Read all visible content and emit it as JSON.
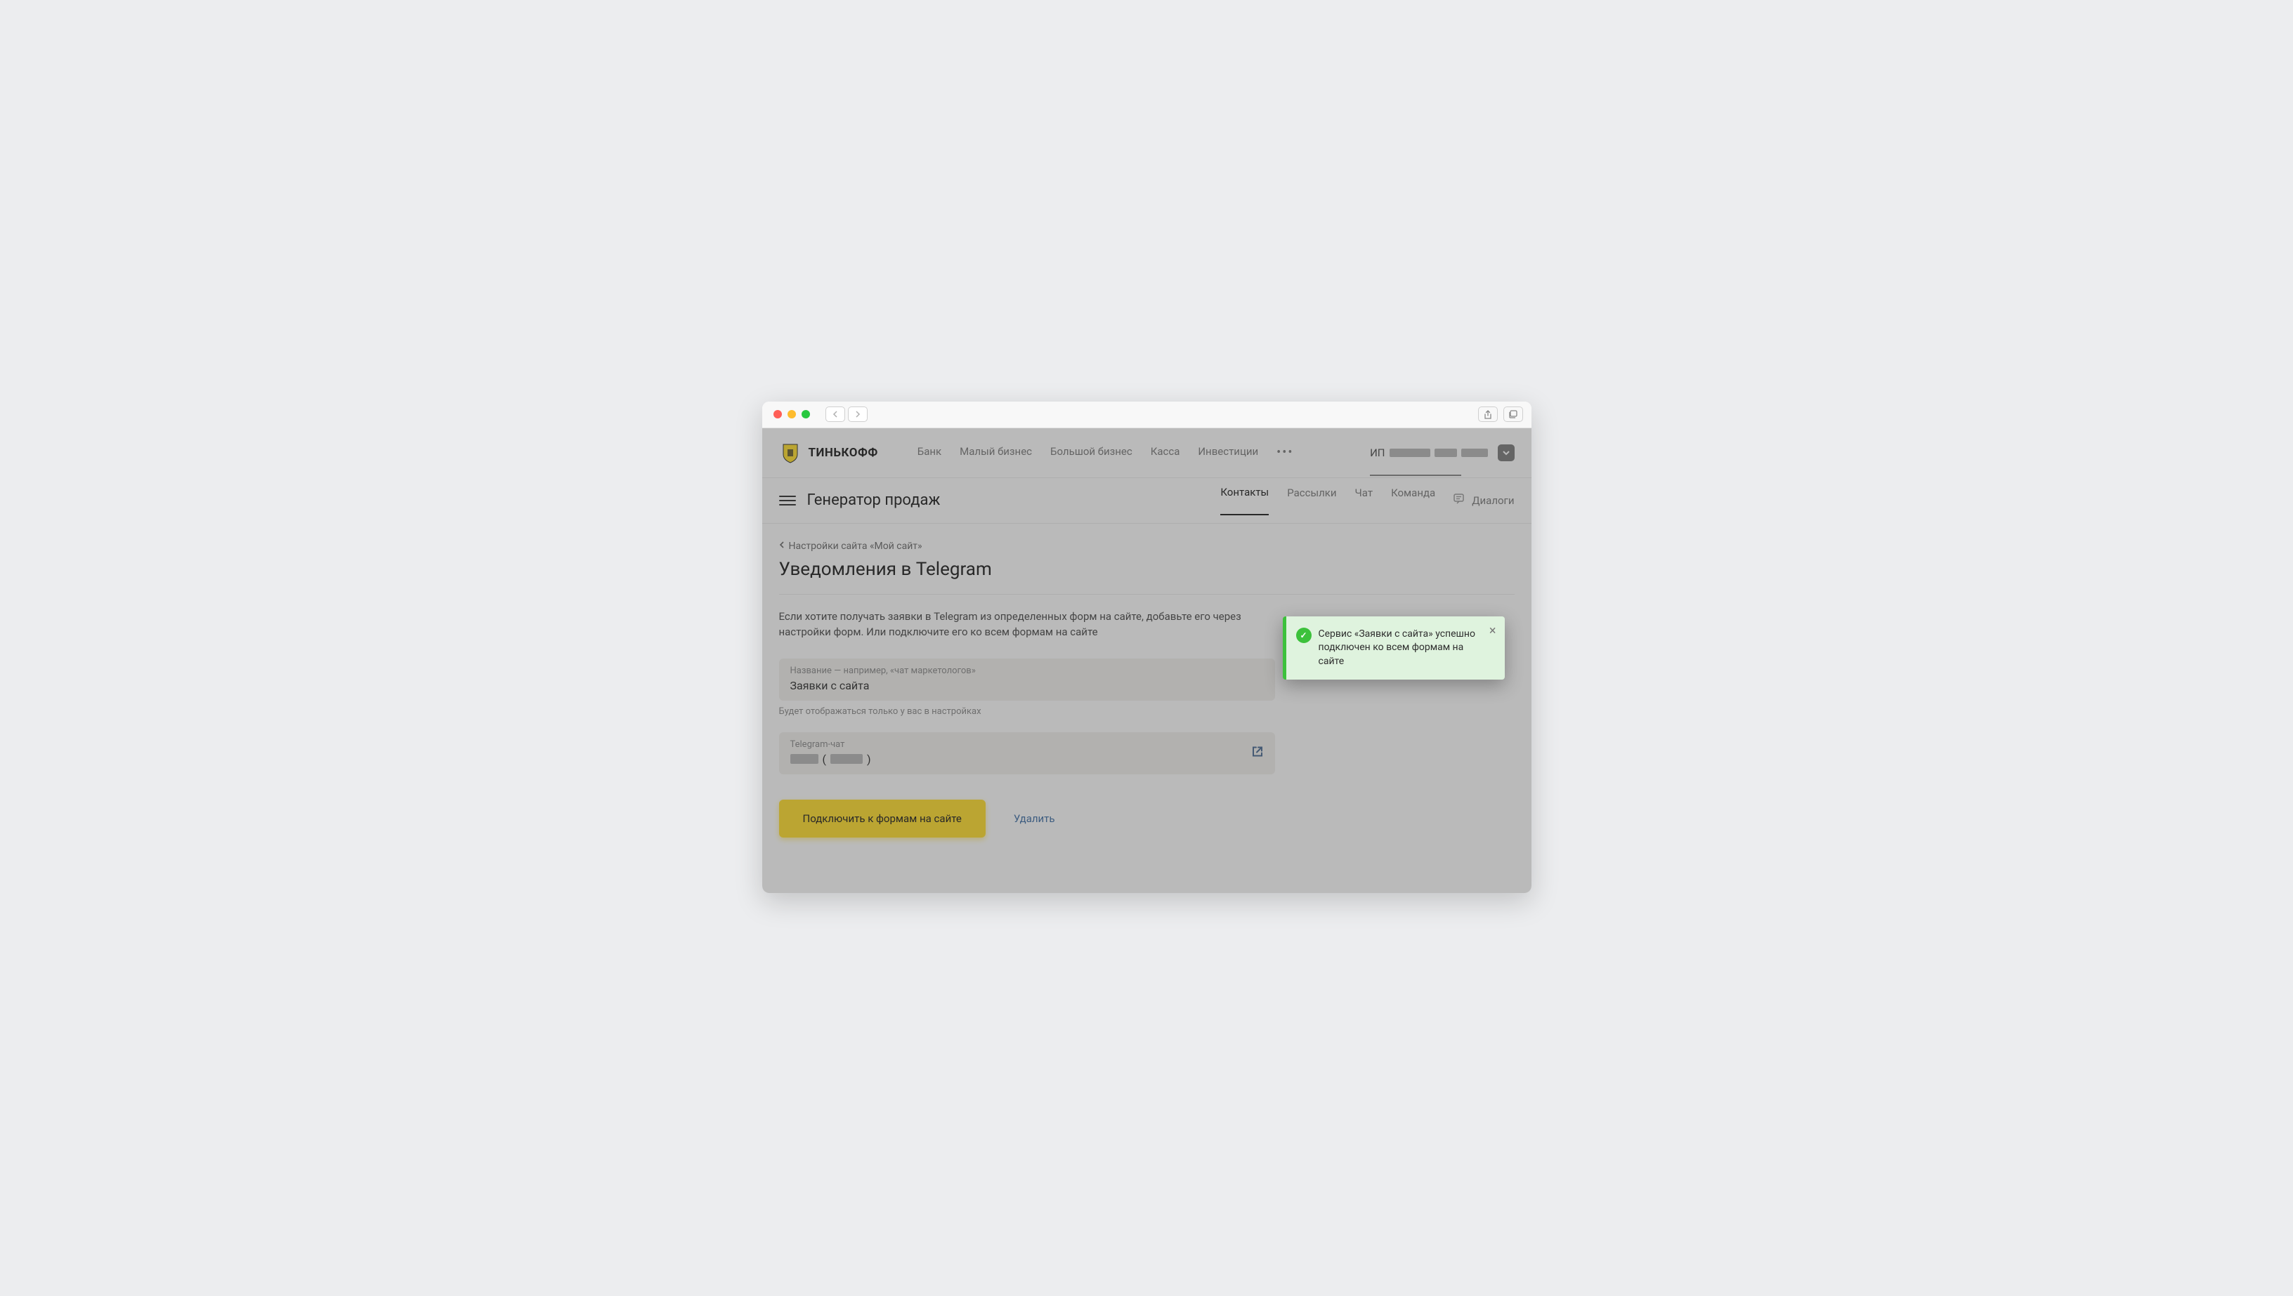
{
  "brand": "ТИНЬКОФФ",
  "topnav": {
    "links": [
      "Банк",
      "Малый бизнес",
      "Большой бизнес",
      "Касса",
      "Инвестиции"
    ],
    "account_prefix": "ИП"
  },
  "subnav": {
    "title": "Генератор продаж",
    "links": [
      "Контакты",
      "Рассылки",
      "Чат",
      "Команда"
    ],
    "dialogs": "Диалоги"
  },
  "breadcrumb": "Настройки сайта «Мой сайт»",
  "page_title": "Уведомления в Telegram",
  "description": "Если хотите получать заявки в Telegram из определенных форм на сайте, добавьте его через настройки форм. Или подключите его ко всем формам на сайте",
  "name_field": {
    "label": "Название — например, «чат маркетологов»",
    "value": "Заявки с сайта",
    "hint": "Будет отображаться только у вас в настройках"
  },
  "chat_field": {
    "label": "Telegram-чат",
    "paren_open": "(",
    "paren_close": ")"
  },
  "actions": {
    "primary": "Подключить к формам на сайте",
    "delete": "Удалить"
  },
  "toast": "Сервис «Заявки с сайта» успешно подключен ко всем формам на сайте"
}
